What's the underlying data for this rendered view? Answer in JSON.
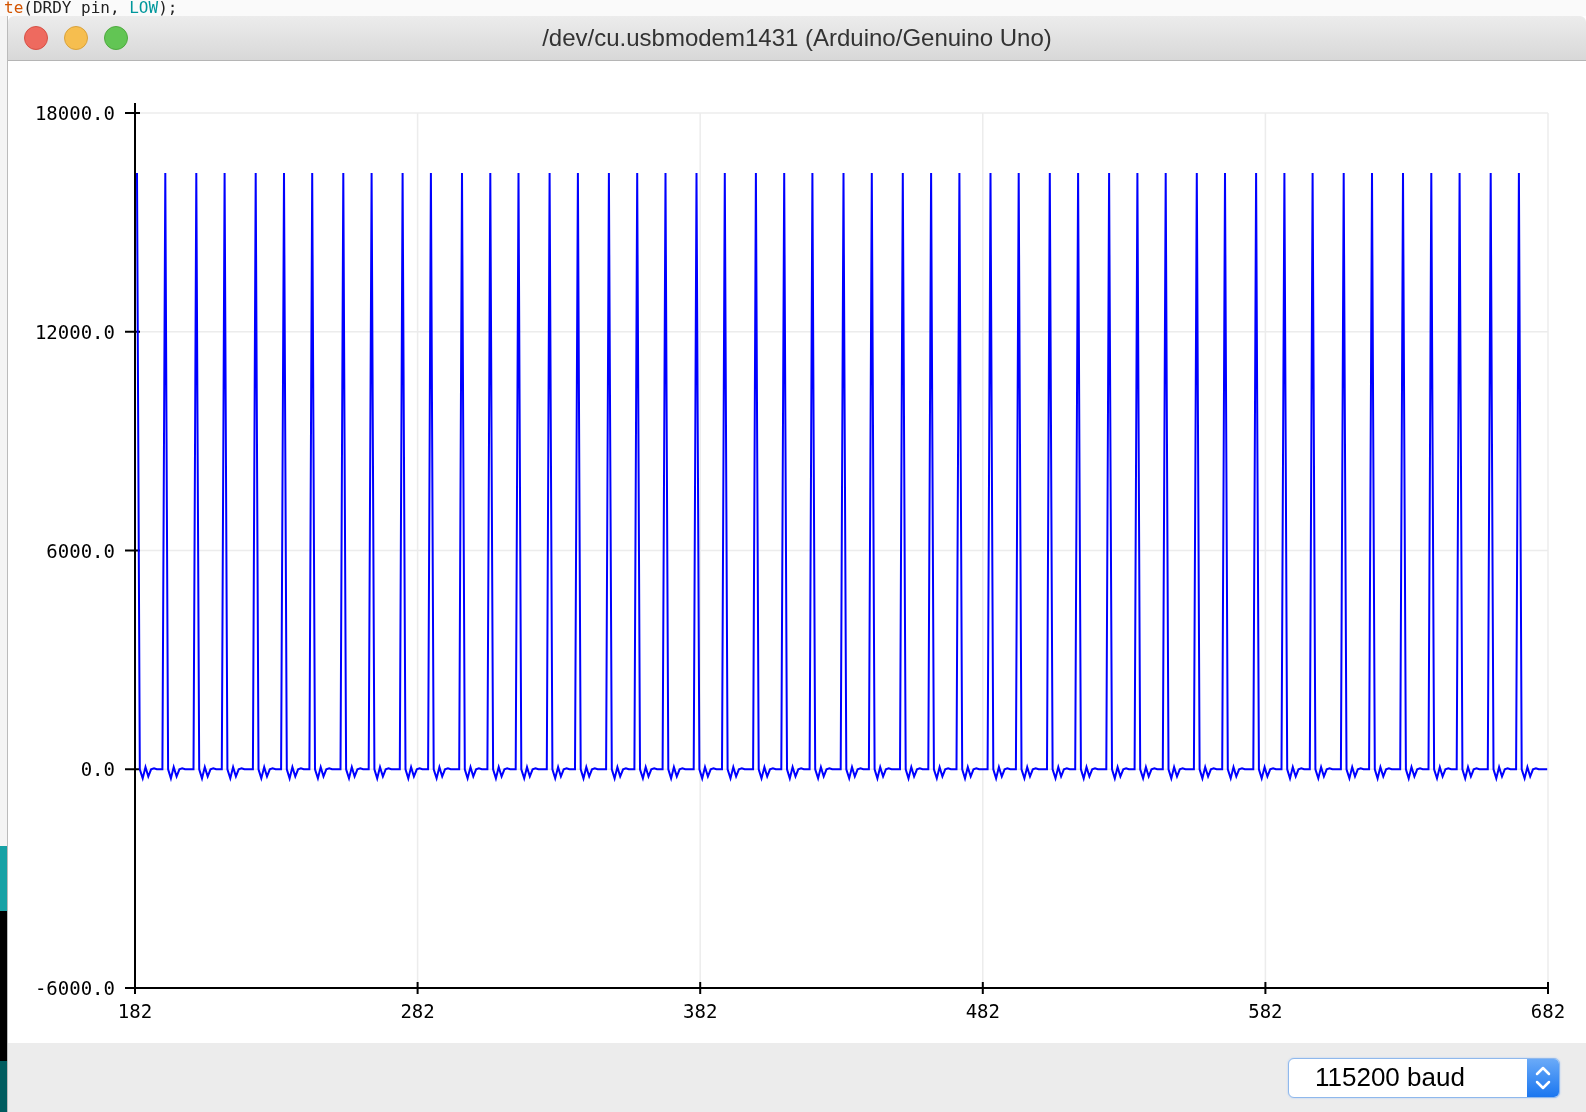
{
  "background_editor": {
    "code_line": [
      {
        "text": "te",
        "kind": "function"
      },
      {
        "text": "(DRDY pin, ",
        "kind": "plain"
      },
      {
        "text": "LOW",
        "kind": "constant"
      },
      {
        "text": ");",
        "kind": "plain"
      }
    ]
  },
  "window": {
    "title": "/dev/cu.usbmodem1431 (Arduino/Genuino Uno)"
  },
  "plot": {
    "y_ticks": [
      "18000.0",
      "12000.0",
      "6000.0",
      "0.0",
      "-6000.0"
    ],
    "x_ticks": [
      "182",
      "282",
      "382",
      "482",
      "582",
      "682"
    ]
  },
  "baud_select": {
    "value": "115200 baud"
  }
}
